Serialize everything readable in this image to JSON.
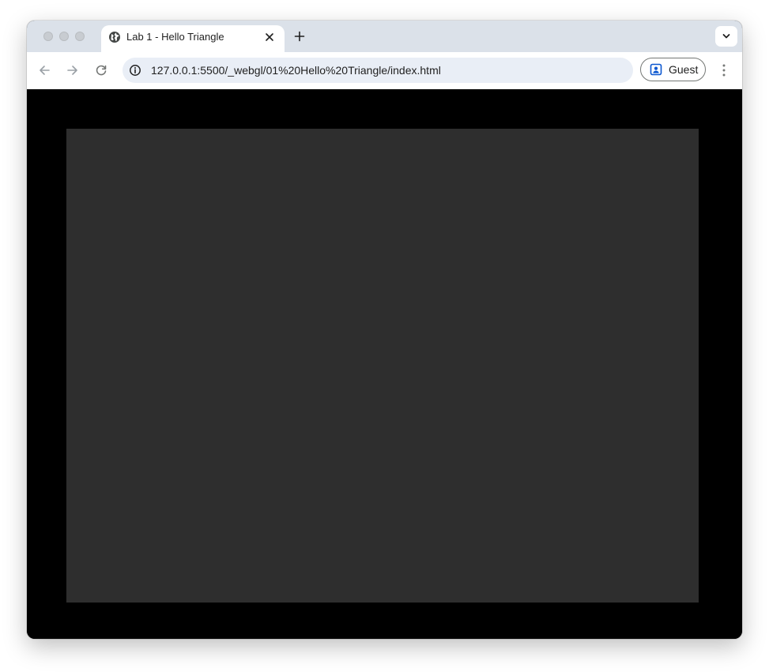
{
  "tab": {
    "title": "Lab 1 - Hello Triangle",
    "favicon": "globe-icon"
  },
  "toolbar": {
    "url": "127.0.0.1:5500/_webgl/01%20Hello%20Triangle/index.html",
    "profile_label": "Guest"
  },
  "page": {
    "background_color": "#000000",
    "canvas_color": "#2e2e2e"
  },
  "colors": {
    "tabstrip": "#dbe1e9",
    "omnibox": "#e9eef6",
    "accent": "#0b57d0"
  }
}
